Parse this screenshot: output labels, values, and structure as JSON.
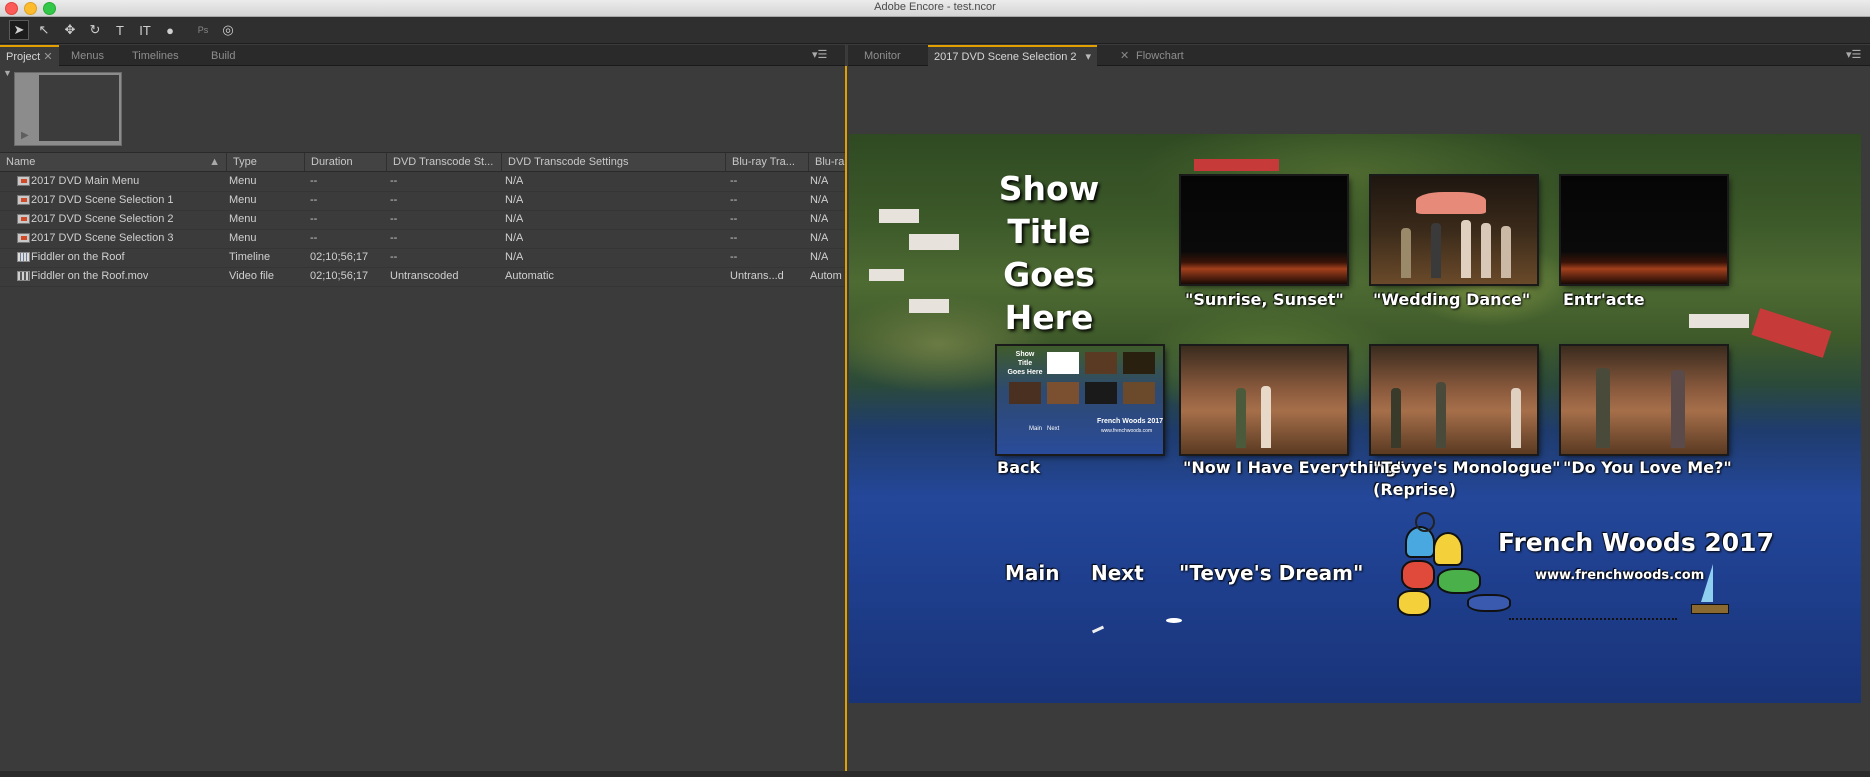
{
  "window": {
    "title": "Adobe Encore - test.ncor"
  },
  "toolbar": {
    "tools": [
      {
        "name": "selection-tool-icon",
        "glyph": "➤",
        "active": true
      },
      {
        "name": "direct-select-tool-icon",
        "glyph": "↖"
      },
      {
        "name": "move-tool-icon",
        "glyph": "✥"
      },
      {
        "name": "rotate-tool-icon",
        "glyph": "↻"
      },
      {
        "name": "text-tool-icon",
        "glyph": "T"
      },
      {
        "name": "vertical-text-tool-icon",
        "glyph": "IT"
      },
      {
        "name": "zoom-tool-icon",
        "glyph": "●"
      },
      {
        "name": "photoshop-icon",
        "glyph": "Ps"
      },
      {
        "name": "preview-icon",
        "glyph": "◎"
      }
    ]
  },
  "left_panel": {
    "tabs": [
      "Project",
      "Menus",
      "Timelines",
      "Build"
    ],
    "active_tab": "Project",
    "columns": [
      "Name",
      "Type",
      "Duration",
      "DVD Transcode St...",
      "DVD Transcode Settings",
      "Blu-ray Tra...",
      "Blu-ra"
    ],
    "rows": [
      {
        "icon": "main-menu",
        "name": "2017 DVD Main Menu",
        "type": "Menu",
        "duration": "--",
        "dvd_status": "--",
        "dvd_settings": "N/A",
        "bluray_status": "--",
        "bluray_settings": "N/A"
      },
      {
        "icon": "menu",
        "name": "2017 DVD Scene Selection 1",
        "type": "Menu",
        "duration": "--",
        "dvd_status": "--",
        "dvd_settings": "N/A",
        "bluray_status": "--",
        "bluray_settings": "N/A"
      },
      {
        "icon": "menu",
        "name": "2017 DVD Scene Selection 2",
        "type": "Menu",
        "duration": "--",
        "dvd_status": "--",
        "dvd_settings": "N/A",
        "bluray_status": "--",
        "bluray_settings": "N/A"
      },
      {
        "icon": "menu",
        "name": "2017 DVD Scene Selection 3",
        "type": "Menu",
        "duration": "--",
        "dvd_status": "--",
        "dvd_settings": "N/A",
        "bluray_status": "--",
        "bluray_settings": "N/A"
      },
      {
        "icon": "timeline",
        "name": "Fiddler on the Roof",
        "type": "Timeline",
        "duration": "02;10;56;17",
        "dvd_status": "--",
        "dvd_settings": "N/A",
        "bluray_status": "--",
        "bluray_settings": "N/A"
      },
      {
        "icon": "video",
        "name": "Fiddler on the Roof.mov",
        "type": "Video file",
        "duration": "02;10;56;17",
        "dvd_status": "Untranscoded",
        "dvd_settings": "Automatic",
        "bluray_status": "Untrans...d",
        "bluray_settings": "Autom"
      }
    ]
  },
  "right_panel": {
    "tabs": [
      "Monitor",
      "2017 DVD Scene Selection 2",
      "Flowchart"
    ],
    "active_tab": "2017 DVD Scene Selection 2"
  },
  "menu_canvas": {
    "show_title": [
      "Show",
      "Title",
      "Goes Here"
    ],
    "chapters": [
      {
        "label": "\"Sunrise, Sunset\""
      },
      {
        "label": "\"Wedding Dance\""
      },
      {
        "label": "Entr'acte"
      },
      {
        "label": "Back"
      },
      {
        "label": "\"Now I Have Everything\""
      },
      {
        "label": "\"Tevye's Monologue\"",
        "label2": "(Reprise)"
      },
      {
        "label": "\"Do You Love Me?\""
      }
    ],
    "nav": {
      "main": "Main",
      "next": "Next",
      "tevye_dream": "\"Tevye's Dream\""
    },
    "brand": {
      "title": "French Woods 2017",
      "url": "www.frenchwoods.com"
    },
    "mini_thumb": {
      "title": [
        "Show",
        "Title",
        "Goes Here"
      ],
      "main": "Main",
      "next": "Next",
      "brand": "French Woods 2017",
      "url": "www.frenchwoods.com"
    }
  }
}
